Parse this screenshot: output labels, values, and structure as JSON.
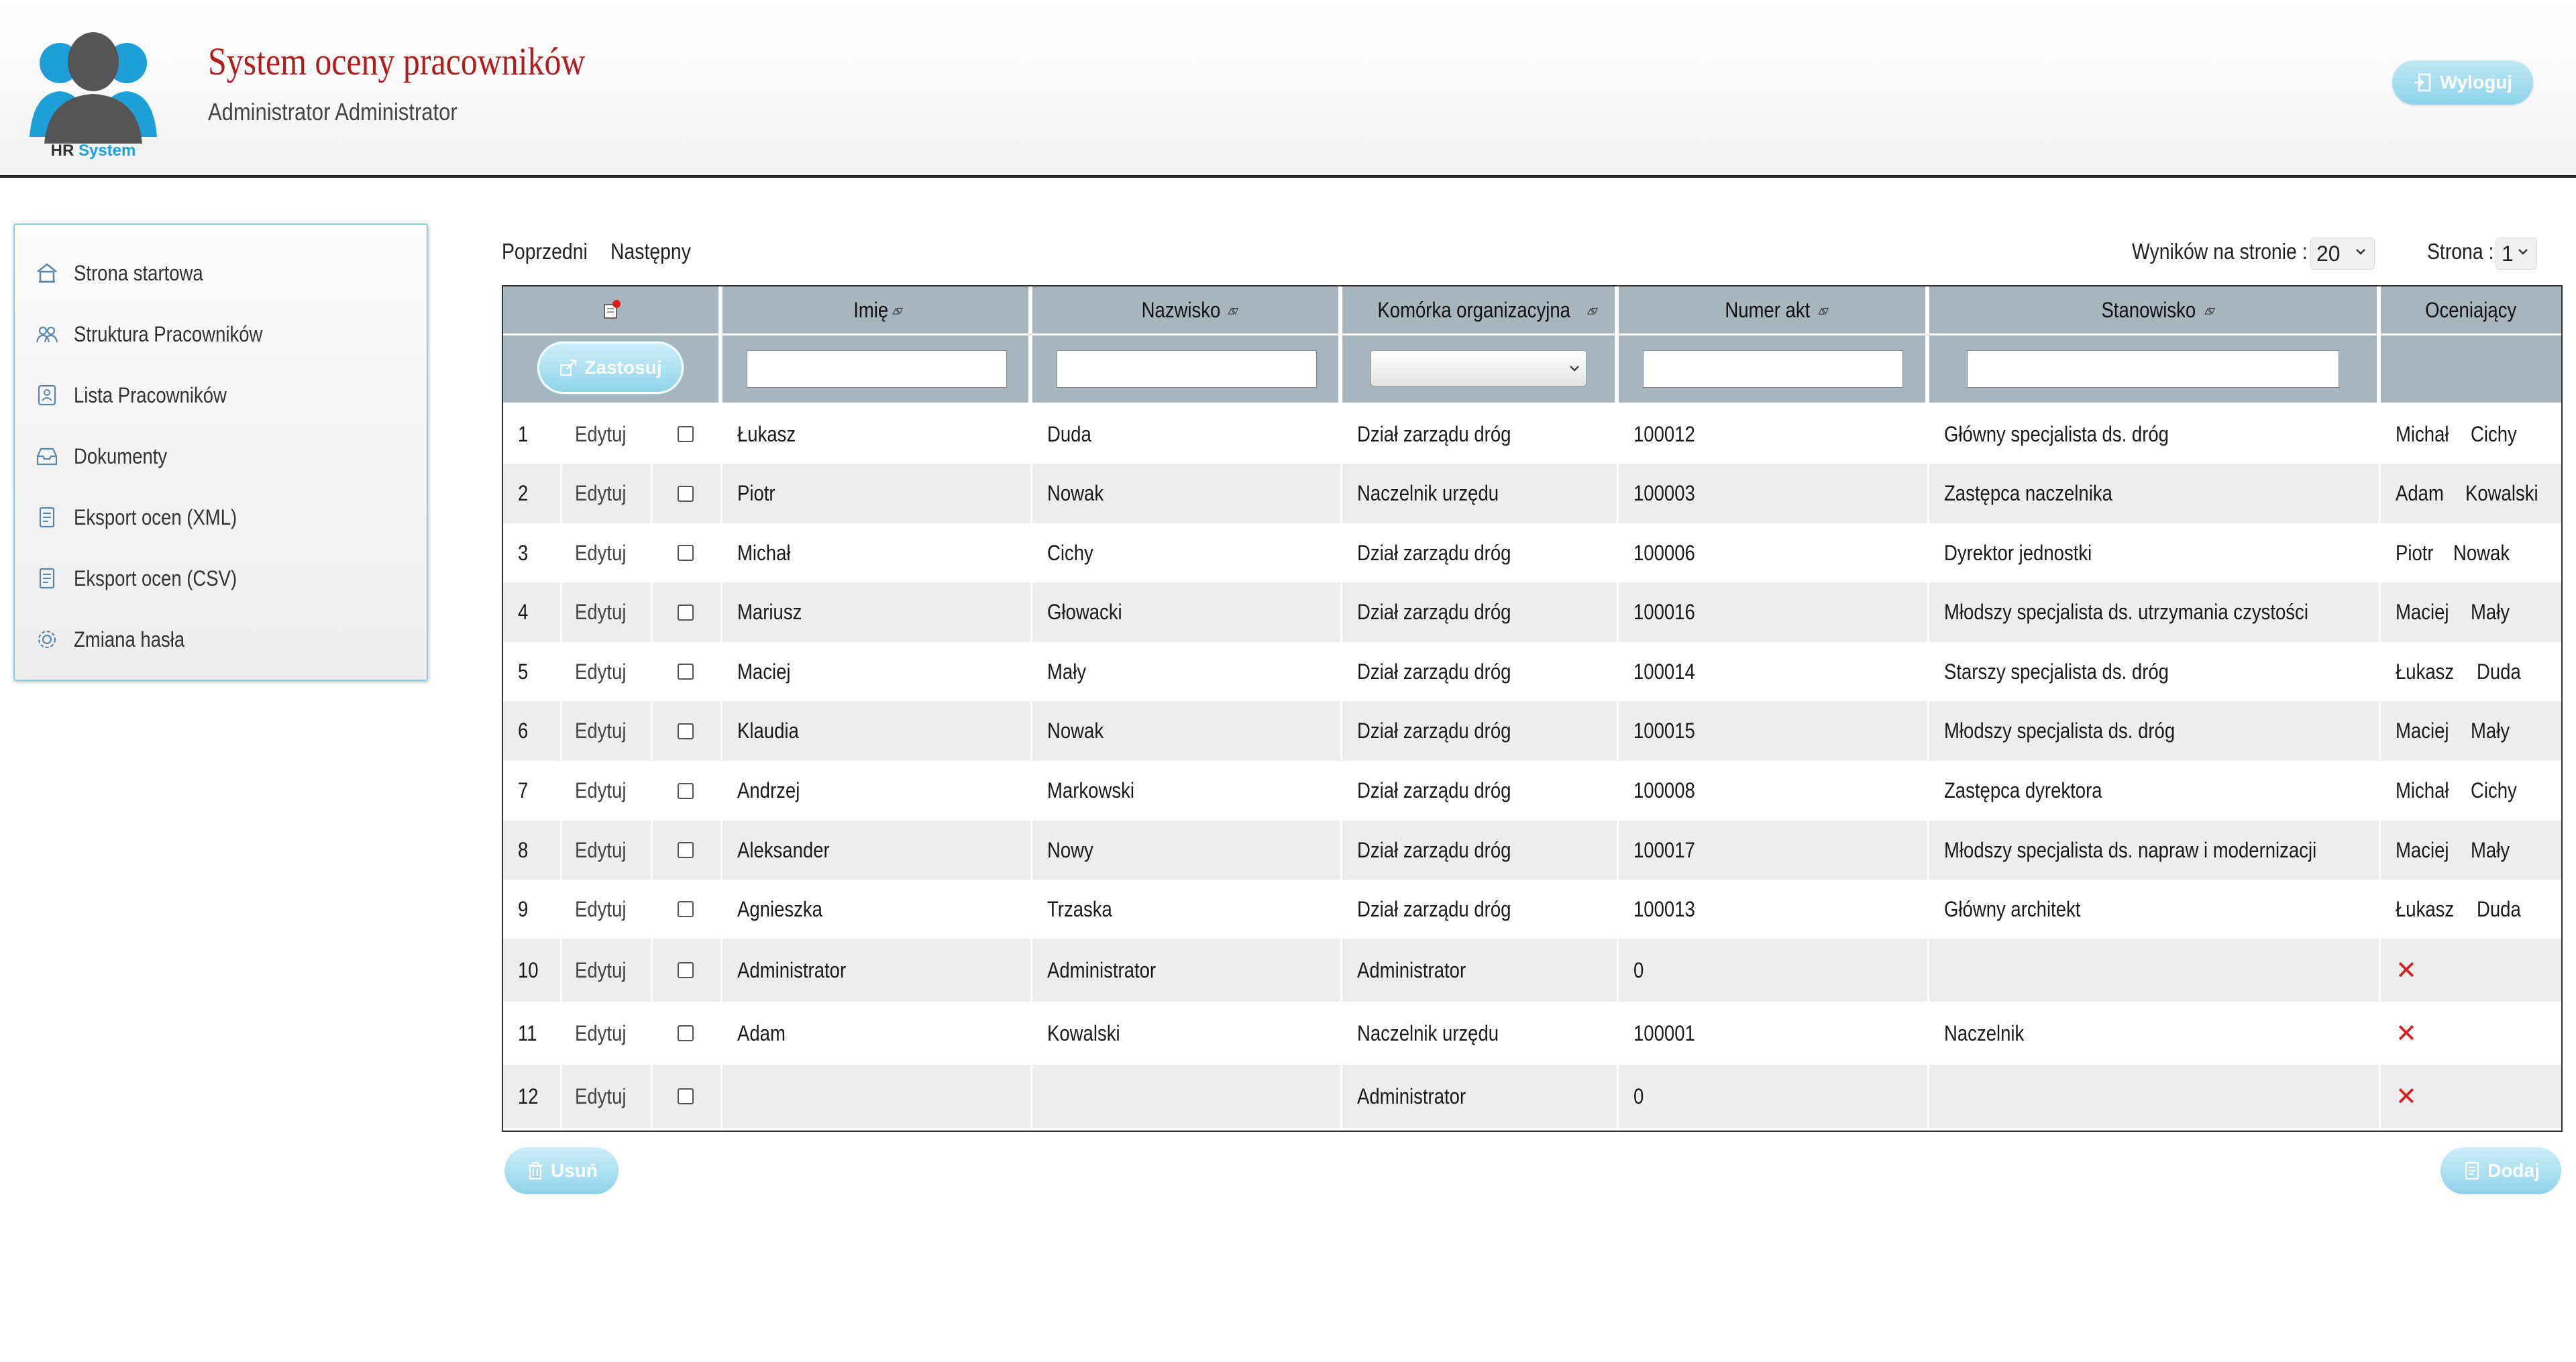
{
  "header": {
    "logo_text_a": "HR",
    "logo_text_b": "System",
    "title": "System oceny pracowników",
    "user": "Administrator Administrator",
    "logout_label": "Wyloguj"
  },
  "sidebar": {
    "items": [
      {
        "label": "Strona startowa",
        "icon": "home-icon"
      },
      {
        "label": "Struktura Pracowników",
        "icon": "people-icon"
      },
      {
        "label": "Lista Pracowników",
        "icon": "list-icon"
      },
      {
        "label": "Dokumenty",
        "icon": "inbox-icon"
      },
      {
        "label": "Eksport ocen (XML)",
        "icon": "document-icon"
      },
      {
        "label": "Eksport ocen (CSV)",
        "icon": "document-icon"
      },
      {
        "label": "Zmiana hasła",
        "icon": "gear-icon"
      }
    ]
  },
  "pager": {
    "prev": "Poprzedni",
    "next": "Następny",
    "per_page_label": "Wyników na stronie :",
    "per_page_value": "20",
    "page_label": "Strona :",
    "page_value": "1"
  },
  "table": {
    "columns": [
      "Imię",
      "Nazwisko",
      "Komórka organizacyjna",
      "Numer akt",
      "Stanowisko",
      "Oceniający"
    ],
    "apply_label": "Zastosuj",
    "edit_label": "Edytuj",
    "rows": [
      {
        "no": "1",
        "first": "Łukasz",
        "last": "Duda",
        "unit": "Dział zarządu dróg",
        "file": "100012",
        "position": "Główny specjalista ds. dróg",
        "rater_first": "Michał",
        "rater_last": "Cichy"
      },
      {
        "no": "2",
        "first": "Piotr",
        "last": "Nowak",
        "unit": "Naczelnik urzędu",
        "file": "100003",
        "position": "Zastępca naczelnika",
        "rater_first": "Adam",
        "rater_last": "Kowalski"
      },
      {
        "no": "3",
        "first": "Michał",
        "last": "Cichy",
        "unit": "Dział zarządu dróg",
        "file": "100006",
        "position": "Dyrektor jednostki",
        "rater_first": "Piotr",
        "rater_last": "Nowak"
      },
      {
        "no": "4",
        "first": "Mariusz",
        "last": "Głowacki",
        "unit": "Dział zarządu dróg",
        "file": "100016",
        "position": "Młodszy specjalista ds. utrzymania czystości",
        "rater_first": "Maciej",
        "rater_last": "Mały"
      },
      {
        "no": "5",
        "first": "Maciej",
        "last": "Mały",
        "unit": "Dział zarządu dróg",
        "file": "100014",
        "position": "Starszy specjalista ds. dróg",
        "rater_first": "Łukasz",
        "rater_last": "Duda"
      },
      {
        "no": "6",
        "first": "Klaudia",
        "last": "Nowak",
        "unit": "Dział zarządu dróg",
        "file": "100015",
        "position": "Młodszy specjalista ds. dróg",
        "rater_first": "Maciej",
        "rater_last": "Mały"
      },
      {
        "no": "7",
        "first": "Andrzej",
        "last": "Markowski",
        "unit": "Dział zarządu dróg",
        "file": "100008",
        "position": "Zastępca dyrektora",
        "rater_first": "Michał",
        "rater_last": "Cichy"
      },
      {
        "no": "8",
        "first": "Aleksander",
        "last": "Nowy",
        "unit": "Dział zarządu dróg",
        "file": "100017",
        "position": "Młodszy specjalista ds. napraw i modernizacji",
        "rater_first": "Maciej",
        "rater_last": "Mały"
      },
      {
        "no": "9",
        "first": "Agnieszka",
        "last": "Trzaska",
        "unit": "Dział zarządu dróg",
        "file": "100013",
        "position": "Główny architekt",
        "rater_first": "Łukasz",
        "rater_last": "Duda"
      },
      {
        "no": "10",
        "first": "Administrator",
        "last": "Administrator",
        "unit": "Administrator",
        "file": "0",
        "position": "",
        "rater_first": "",
        "rater_last": "",
        "no_rater": true
      },
      {
        "no": "11",
        "first": "Adam",
        "last": "Kowalski",
        "unit": "Naczelnik urzędu",
        "file": "100001",
        "position": "Naczelnik",
        "rater_first": "",
        "rater_last": "",
        "no_rater": true
      },
      {
        "no": "12",
        "first": "",
        "last": "",
        "unit": "Administrator",
        "file": "0",
        "position": "",
        "rater_first": "",
        "rater_last": "",
        "no_rater": true
      }
    ]
  },
  "actions": {
    "delete_label": "Usuń",
    "add_label": "Dodaj"
  },
  "colors": {
    "title": "#b01c1c",
    "header_cell": "#a7b5bf",
    "button": "#8fd4ea",
    "row_alt": "#ededed",
    "no_rater_mark": "#d62020"
  }
}
